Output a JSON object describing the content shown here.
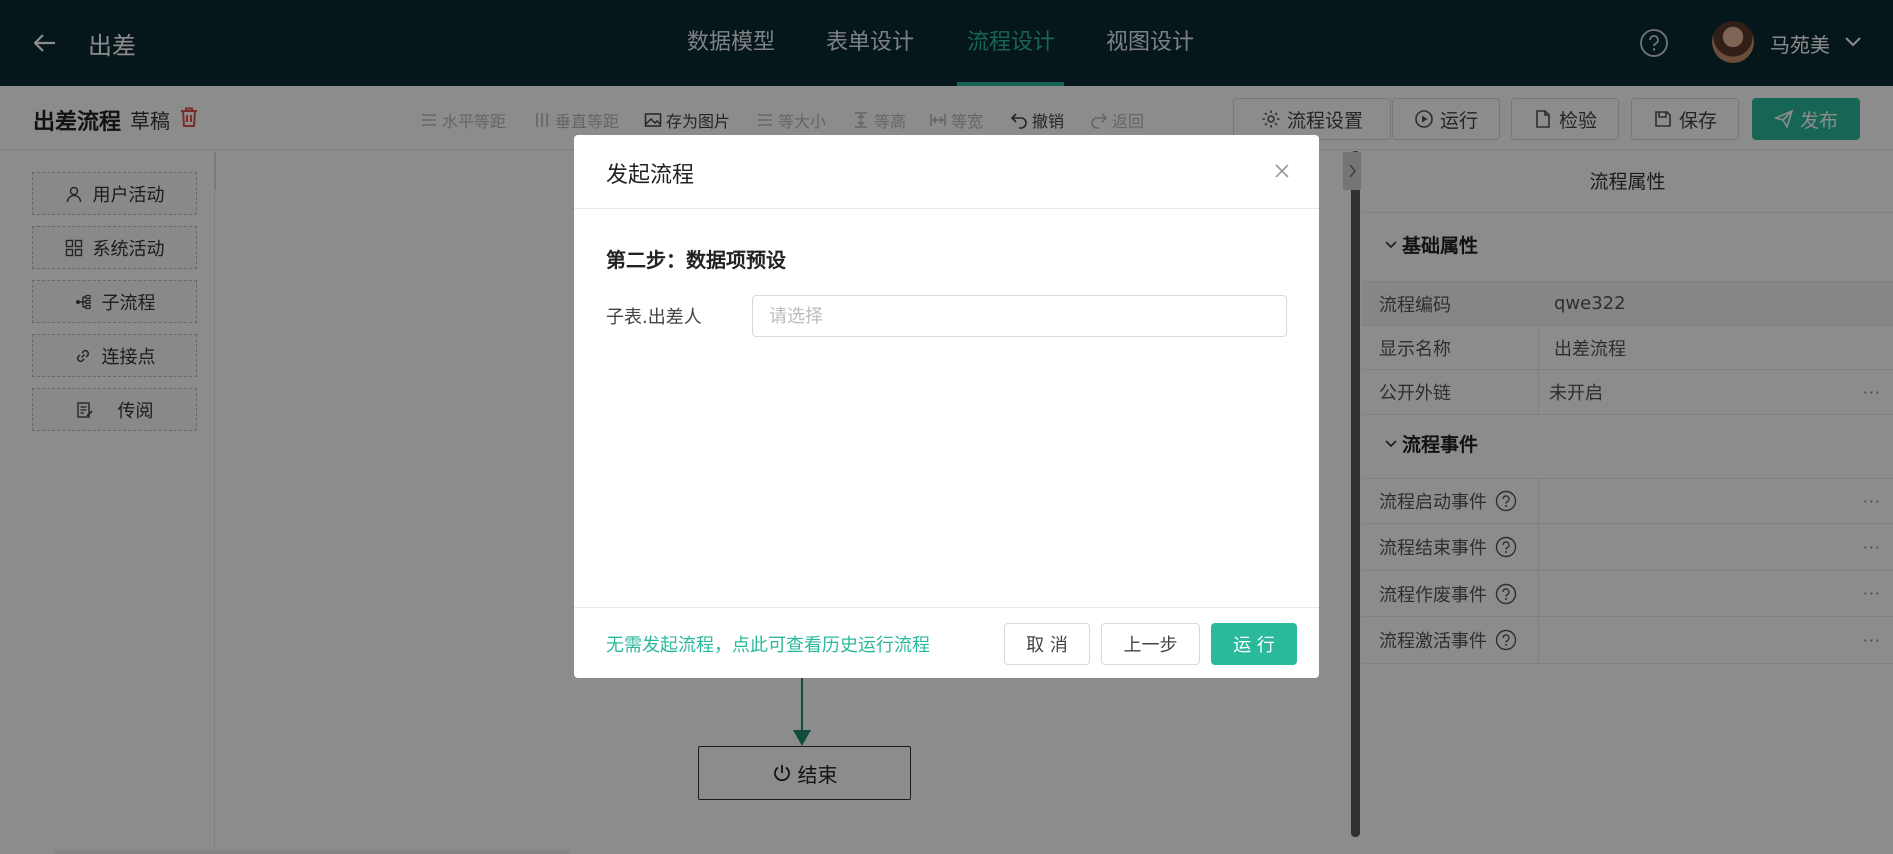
{
  "header": {
    "app_title": "出差",
    "tabs": [
      {
        "label": "数据模型",
        "active": false
      },
      {
        "label": "表单设计",
        "active": false
      },
      {
        "label": "流程设计",
        "active": true
      },
      {
        "label": "视图设计",
        "active": false
      }
    ],
    "user_name": "马苑美",
    "icons": {
      "back": "back-arrow-icon",
      "help": "help-icon",
      "user_menu": "chevron-down-icon"
    }
  },
  "toolbar": {
    "flow_name": "出差流程",
    "status": "草稿",
    "tools": [
      {
        "label": "水平等距",
        "enabled": false,
        "icon": "horizontal-distribute-icon"
      },
      {
        "label": "垂直等距",
        "enabled": false,
        "icon": "vertical-distribute-icon"
      },
      {
        "label": "存为图片",
        "enabled": true,
        "icon": "image-icon"
      },
      {
        "label": "等大小",
        "enabled": false,
        "icon": "same-size-icon"
      },
      {
        "label": "等高",
        "enabled": false,
        "icon": "same-height-icon"
      },
      {
        "label": "等宽",
        "enabled": false,
        "icon": "same-width-icon"
      },
      {
        "label": "撤销",
        "enabled": true,
        "icon": "undo-icon"
      },
      {
        "label": "返回",
        "enabled": false,
        "icon": "redo-icon"
      }
    ],
    "buttons": {
      "settings": "流程设置",
      "run": "运行",
      "check": "检验",
      "save": "保存",
      "publish": "发布"
    }
  },
  "palette": {
    "items": [
      {
        "label": "用户活动",
        "icon": "user-icon"
      },
      {
        "label": "系统活动",
        "icon": "grid-icon"
      },
      {
        "label": "子流程",
        "icon": "subflow-icon"
      },
      {
        "label": "连接点",
        "icon": "link-icon"
      },
      {
        "label": "传阅",
        "icon": "circulate-icon"
      }
    ]
  },
  "canvas": {
    "end_node_label": "结束"
  },
  "properties": {
    "title": "流程属性",
    "basic_section": "基础属性",
    "basic_rows": [
      {
        "label": "流程编码",
        "value": "qwe322"
      },
      {
        "label": "显示名称",
        "value": "出差流程"
      },
      {
        "label": "公开外链",
        "value": "未开启",
        "more": "···"
      }
    ],
    "events_section": "流程事件",
    "event_rows": [
      {
        "label": "流程启动事件",
        "value": "",
        "more": "···"
      },
      {
        "label": "流程结束事件",
        "value": "",
        "more": "···"
      },
      {
        "label": "流程作废事件",
        "value": "",
        "more": "···"
      },
      {
        "label": "流程激活事件",
        "value": "",
        "more": "···"
      }
    ]
  },
  "modal": {
    "title": "发起流程",
    "step_title": "第二步：数据项预设",
    "field_label": "子表.出差人",
    "field_placeholder": "请选择",
    "field_value": "",
    "history_link": "无需发起流程，点此可查看历史运行流程",
    "cancel": "取 消",
    "prev": "上一步",
    "run": "运 行"
  },
  "colors": {
    "accent": "#2bb99b",
    "topbar": "#0c2a33",
    "danger": "#e05050"
  }
}
